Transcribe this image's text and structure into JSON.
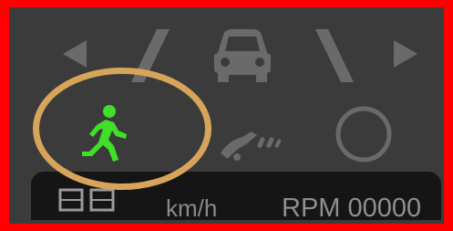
{
  "screen": {
    "colors": {
      "frame": "#ff0000",
      "panel": "#3b3b3b",
      "icon_inactive": "#6a6a6a",
      "pedestrian_active": "#3fdf2a",
      "highlight_ring": "#d6a55a",
      "bottom_bar": "#151515",
      "bottom_text": "#8f8f8f"
    }
  },
  "indicators": {
    "top_row": [
      "left-arrow-icon",
      "left-lane-line-icon",
      "car-icon",
      "right-lane-line-icon",
      "right-arrow-icon"
    ],
    "middle_row": [
      "pedestrian-icon",
      "road-spray-icon",
      "circle-icon"
    ],
    "pedestrian_state": "active"
  },
  "status_bar": {
    "speed_unit": "km/h",
    "rpm_text": "RPM 00000"
  }
}
